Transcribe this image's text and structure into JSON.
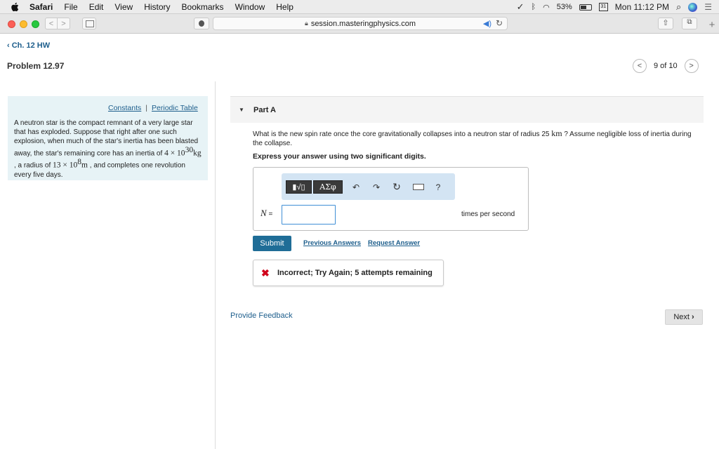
{
  "menubar": {
    "items": [
      "Safari",
      "File",
      "Edit",
      "View",
      "History",
      "Bookmarks",
      "Window",
      "Help"
    ],
    "battery": "53%",
    "clock": "Mon 11:12 PM",
    "calendar_day": "31"
  },
  "browser": {
    "url": "session.masteringphysics.com"
  },
  "page": {
    "breadcrumb": "Ch. 12 HW",
    "problem_title": "Problem 12.97",
    "pager": "9 of 10"
  },
  "info": {
    "constants_link": "Constants",
    "separator": "|",
    "periodic_link": "Periodic Table",
    "text_1": "A neutron star is the compact remnant of a very large star that has exploded. Suppose that right after one such explosion, when much of the star's inertia has been blasted away, the star's remaining core has an inertia of ",
    "inertia_value": "4 × 10",
    "inertia_exp": "30",
    "inertia_unit": "kg",
    "text_2": " , a radius of ",
    "radius_value": "13 × 10",
    "radius_exp": "8",
    "radius_unit": "m",
    "text_3": " , and completes one revolution every five days."
  },
  "part": {
    "title": "Part A",
    "question_1": "What is the new spin rate once the core gravitationally collapses into a neutron star of radius 25 ",
    "question_unit": "km",
    "question_2": " ? Assume negligible loss of inertia during the collapse.",
    "instruction": "Express your answer using two significant digits."
  },
  "answer": {
    "template_button": "▮√▯",
    "greek_button": "ΑΣφ",
    "help_button": "?",
    "variable": "N",
    "equals": " =",
    "input_value": "",
    "units": "times per second"
  },
  "actions": {
    "submit_label": "Submit",
    "previous_answers": "Previous Answers",
    "request_answer": "Request Answer"
  },
  "feedback": {
    "message": "Incorrect; Try Again; 5 attempts remaining"
  },
  "footer": {
    "provide_feedback": "Provide Feedback",
    "next_label": "Next"
  },
  "colors": {
    "link": "#1d5e8c",
    "submit_bg": "#1f6d97",
    "info_bg": "#e7f3f6",
    "error": "#d0021b"
  }
}
